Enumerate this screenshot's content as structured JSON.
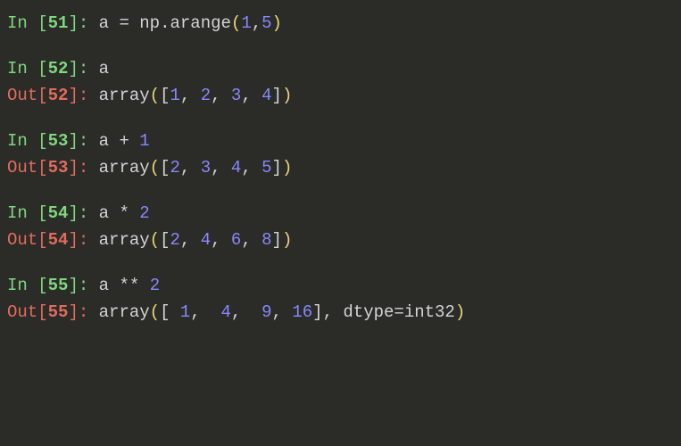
{
  "cells": [
    {
      "in_num": "51",
      "in_tokens": [
        "a",
        " ",
        "=",
        " ",
        "np",
        ".",
        "arange",
        "(",
        "1",
        ",",
        "5",
        ")"
      ],
      "in_classes": [
        "ident",
        "code",
        "eq",
        "code",
        "ident",
        "code",
        "ident",
        "paren",
        "number",
        "code",
        "number",
        "paren"
      ]
    },
    {
      "in_num": "52",
      "in_tokens": [
        "a"
      ],
      "in_classes": [
        "ident"
      ],
      "out_num": "52",
      "out_tokens": [
        "array",
        "(",
        "[",
        "1",
        ",",
        " ",
        "2",
        ",",
        " ",
        "3",
        ",",
        " ",
        "4",
        "]",
        ")"
      ],
      "out_classes": [
        "ident",
        "paren",
        "code",
        "number",
        "code",
        "code",
        "number",
        "code",
        "code",
        "number",
        "code",
        "code",
        "number",
        "code",
        "paren"
      ]
    },
    {
      "in_num": "53",
      "in_tokens": [
        "a",
        " ",
        "+",
        " ",
        "1"
      ],
      "in_classes": [
        "ident",
        "code",
        "operator",
        "code",
        "number"
      ],
      "out_num": "53",
      "out_tokens": [
        "array",
        "(",
        "[",
        "2",
        ",",
        " ",
        "3",
        ",",
        " ",
        "4",
        ",",
        " ",
        "5",
        "]",
        ")"
      ],
      "out_classes": [
        "ident",
        "paren",
        "code",
        "number",
        "code",
        "code",
        "number",
        "code",
        "code",
        "number",
        "code",
        "code",
        "number",
        "code",
        "paren"
      ]
    },
    {
      "in_num": "54",
      "in_tokens": [
        "a",
        " ",
        "*",
        " ",
        "2"
      ],
      "in_classes": [
        "ident",
        "code",
        "operator",
        "code",
        "number"
      ],
      "out_num": "54",
      "out_tokens": [
        "array",
        "(",
        "[",
        "2",
        ",",
        " ",
        "4",
        ",",
        " ",
        "6",
        ",",
        " ",
        "8",
        "]",
        ")"
      ],
      "out_classes": [
        "ident",
        "paren",
        "code",
        "number",
        "code",
        "code",
        "number",
        "code",
        "code",
        "number",
        "code",
        "code",
        "number",
        "code",
        "paren"
      ]
    },
    {
      "in_num": "55",
      "in_tokens": [
        "a",
        " ",
        "**",
        " ",
        "2"
      ],
      "in_classes": [
        "ident",
        "code",
        "operator",
        "code",
        "number"
      ],
      "out_num": "55",
      "out_tokens": [
        "array",
        "(",
        "[",
        " ",
        "1",
        ",",
        "  ",
        "4",
        ",",
        "  ",
        "9",
        ",",
        " ",
        "16",
        "]",
        ",",
        " ",
        "dtype",
        "=",
        "int32",
        ")"
      ],
      "out_classes": [
        "ident",
        "paren",
        "code",
        "code",
        "number",
        "code",
        "code",
        "number",
        "code",
        "code",
        "number",
        "code",
        "code",
        "number",
        "code",
        "code",
        "code",
        "ident",
        "operator",
        "ident",
        "paren"
      ]
    }
  ],
  "labels": {
    "in_prefix": "In ",
    "out_prefix": "Out",
    "colon": ": "
  }
}
